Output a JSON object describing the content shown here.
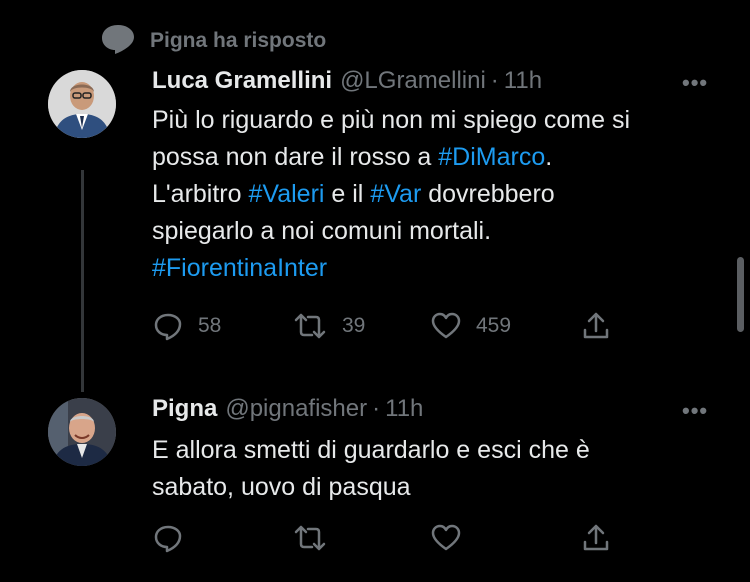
{
  "context": {
    "icon": "speech-bubble-icon",
    "label": "Pigna ha risposto"
  },
  "tweets": [
    {
      "name": "Luca Gramellini",
      "handle": "@LGramellini",
      "separator": "·",
      "time": "11h",
      "more_icon": "•••",
      "text": {
        "l1": "Più lo riguardo e più non mi spiego come si",
        "l2a": "possa non dare il rosso a ",
        "l2h": "#DiMarco",
        "l2b": ".",
        "l3a": "L'arbitro ",
        "l3h1": "#Valeri",
        "l3b": " e il ",
        "l3h2": "#Var",
        "l3c": " dovrebbero",
        "l4": "spiegarlo a noi comuni mortali.",
        "l5h": "#FiorentinaInter"
      },
      "actions": {
        "reply": "58",
        "retweet": "39",
        "like": "459"
      }
    },
    {
      "name": "Pigna",
      "handle": "@pignafisher",
      "separator": "·",
      "time": "11h",
      "more_icon": "•••",
      "text": {
        "l1": "E allora smetti di guardarlo e esci che è",
        "l2": "sabato, uovo di pasqua"
      }
    }
  ],
  "colors": {
    "background": "#000000",
    "text": "#e7e9ea",
    "muted": "#71767b",
    "link": "#1d9bf0"
  }
}
